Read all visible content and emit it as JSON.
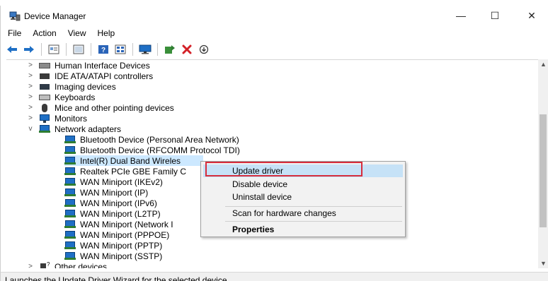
{
  "window": {
    "title": "Device Manager",
    "minimize_glyph": "—",
    "maximize_glyph": "☐",
    "close_glyph": "✕"
  },
  "menu": [
    "File",
    "Action",
    "View",
    "Help"
  ],
  "toolbar": {
    "icons": [
      "back-arrow-icon",
      "forward-arrow-icon",
      "properties-icon",
      "show-hidden-icon",
      "help-icon",
      "view-icon",
      "monitor-icon",
      "update-driver-icon",
      "uninstall-icon",
      "scan-icon"
    ]
  },
  "tree": [
    {
      "label": "Human Interface Devices",
      "expander": ">",
      "icon": "hid-icon"
    },
    {
      "label": "IDE ATA/ATAPI controllers",
      "expander": ">",
      "icon": "ide-icon"
    },
    {
      "label": "Imaging devices",
      "expander": ">",
      "icon": "camera-icon"
    },
    {
      "label": "Keyboards",
      "expander": ">",
      "icon": "keyboard-icon"
    },
    {
      "label": "Mice and other pointing devices",
      "expander": ">",
      "icon": "mouse-icon"
    },
    {
      "label": "Monitors",
      "expander": ">",
      "icon": "monitor-icon"
    },
    {
      "label": "Network adapters",
      "expander": "v",
      "icon": "network-icon"
    },
    {
      "label": "Bluetooth Device (Personal Area Network)",
      "icon": "network-adapter-icon"
    },
    {
      "label": "Bluetooth Device (RFCOMM Protocol TDI)",
      "icon": "network-adapter-icon"
    },
    {
      "label": "Intel(R) Dual Band Wireles",
      "icon": "network-adapter-icon",
      "selected": true
    },
    {
      "label": "Realtek PCIe GBE Family C",
      "icon": "network-adapter-icon"
    },
    {
      "label": "WAN Miniport (IKEv2)",
      "icon": "network-adapter-icon"
    },
    {
      "label": "WAN Miniport (IP)",
      "icon": "network-adapter-icon"
    },
    {
      "label": "WAN Miniport (IPv6)",
      "icon": "network-adapter-icon"
    },
    {
      "label": "WAN Miniport (L2TP)",
      "icon": "network-adapter-icon"
    },
    {
      "label": "WAN Miniport (Network I",
      "icon": "network-adapter-icon"
    },
    {
      "label": "WAN Miniport (PPPOE)",
      "icon": "network-adapter-icon"
    },
    {
      "label": "WAN Miniport (PPTP)",
      "icon": "network-adapter-icon"
    },
    {
      "label": "WAN Miniport (SSTP)",
      "icon": "network-adapter-icon"
    },
    {
      "label": "Other devices",
      "expander": ">",
      "icon": "unknown-device-icon"
    }
  ],
  "context_menu": {
    "items": [
      {
        "label": "Update driver",
        "selected": true
      },
      {
        "label": "Disable device"
      },
      {
        "label": "Uninstall device"
      },
      {
        "label": "Scan for hardware changes"
      },
      {
        "label": "Properties",
        "bold": true
      }
    ],
    "highlight_color": "#d72d3c"
  },
  "status": {
    "text": "Launches the Update Driver Wizard for the selected device."
  }
}
